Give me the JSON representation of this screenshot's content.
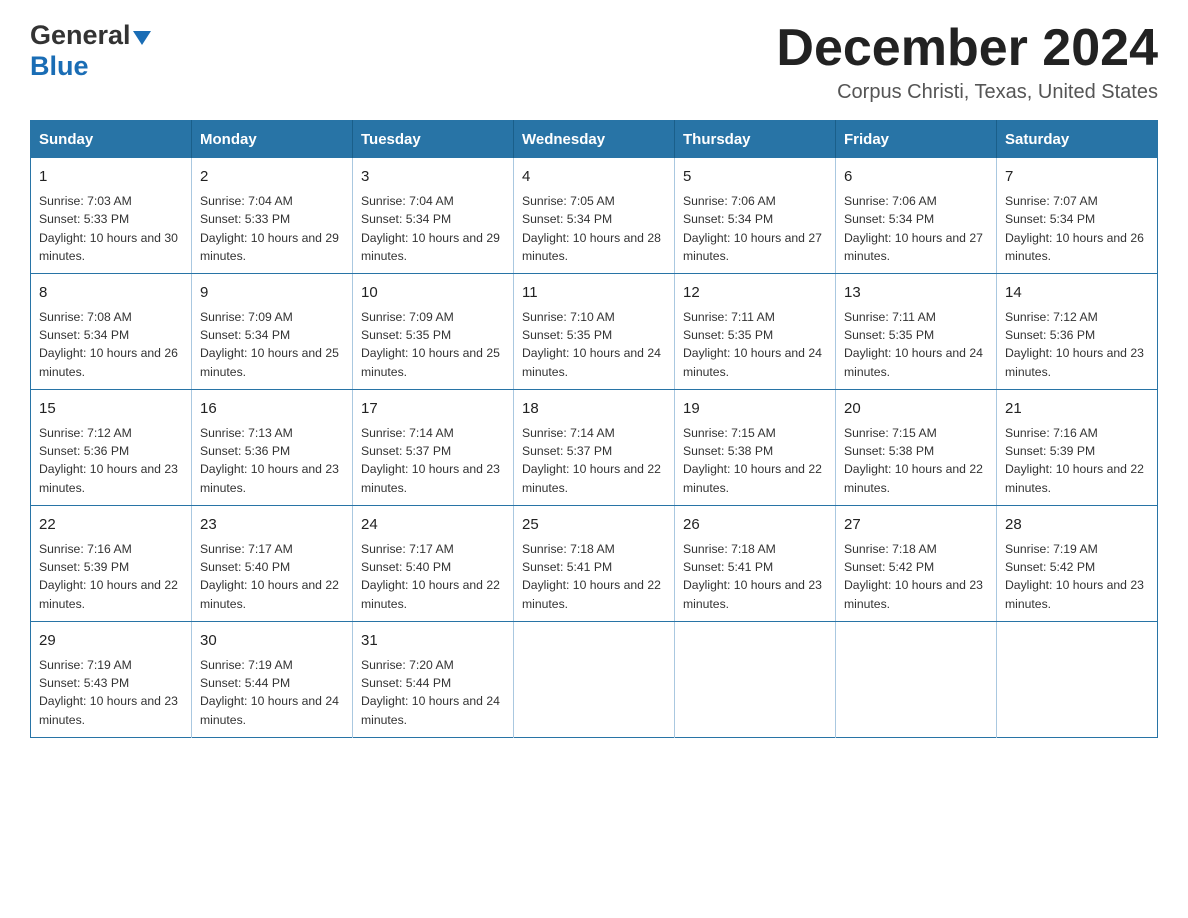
{
  "header": {
    "logo_general": "General",
    "logo_blue": "Blue",
    "title": "December 2024",
    "subtitle": "Corpus Christi, Texas, United States"
  },
  "weekdays": [
    "Sunday",
    "Monday",
    "Tuesday",
    "Wednesday",
    "Thursday",
    "Friday",
    "Saturday"
  ],
  "weeks": [
    [
      {
        "day": "1",
        "sunrise": "7:03 AM",
        "sunset": "5:33 PM",
        "daylight": "10 hours and 30 minutes."
      },
      {
        "day": "2",
        "sunrise": "7:04 AM",
        "sunset": "5:33 PM",
        "daylight": "10 hours and 29 minutes."
      },
      {
        "day": "3",
        "sunrise": "7:04 AM",
        "sunset": "5:34 PM",
        "daylight": "10 hours and 29 minutes."
      },
      {
        "day": "4",
        "sunrise": "7:05 AM",
        "sunset": "5:34 PM",
        "daylight": "10 hours and 28 minutes."
      },
      {
        "day": "5",
        "sunrise": "7:06 AM",
        "sunset": "5:34 PM",
        "daylight": "10 hours and 27 minutes."
      },
      {
        "day": "6",
        "sunrise": "7:06 AM",
        "sunset": "5:34 PM",
        "daylight": "10 hours and 27 minutes."
      },
      {
        "day": "7",
        "sunrise": "7:07 AM",
        "sunset": "5:34 PM",
        "daylight": "10 hours and 26 minutes."
      }
    ],
    [
      {
        "day": "8",
        "sunrise": "7:08 AM",
        "sunset": "5:34 PM",
        "daylight": "10 hours and 26 minutes."
      },
      {
        "day": "9",
        "sunrise": "7:09 AM",
        "sunset": "5:34 PM",
        "daylight": "10 hours and 25 minutes."
      },
      {
        "day": "10",
        "sunrise": "7:09 AM",
        "sunset": "5:35 PM",
        "daylight": "10 hours and 25 minutes."
      },
      {
        "day": "11",
        "sunrise": "7:10 AM",
        "sunset": "5:35 PM",
        "daylight": "10 hours and 24 minutes."
      },
      {
        "day": "12",
        "sunrise": "7:11 AM",
        "sunset": "5:35 PM",
        "daylight": "10 hours and 24 minutes."
      },
      {
        "day": "13",
        "sunrise": "7:11 AM",
        "sunset": "5:35 PM",
        "daylight": "10 hours and 24 minutes."
      },
      {
        "day": "14",
        "sunrise": "7:12 AM",
        "sunset": "5:36 PM",
        "daylight": "10 hours and 23 minutes."
      }
    ],
    [
      {
        "day": "15",
        "sunrise": "7:12 AM",
        "sunset": "5:36 PM",
        "daylight": "10 hours and 23 minutes."
      },
      {
        "day": "16",
        "sunrise": "7:13 AM",
        "sunset": "5:36 PM",
        "daylight": "10 hours and 23 minutes."
      },
      {
        "day": "17",
        "sunrise": "7:14 AM",
        "sunset": "5:37 PM",
        "daylight": "10 hours and 23 minutes."
      },
      {
        "day": "18",
        "sunrise": "7:14 AM",
        "sunset": "5:37 PM",
        "daylight": "10 hours and 22 minutes."
      },
      {
        "day": "19",
        "sunrise": "7:15 AM",
        "sunset": "5:38 PM",
        "daylight": "10 hours and 22 minutes."
      },
      {
        "day": "20",
        "sunrise": "7:15 AM",
        "sunset": "5:38 PM",
        "daylight": "10 hours and 22 minutes."
      },
      {
        "day": "21",
        "sunrise": "7:16 AM",
        "sunset": "5:39 PM",
        "daylight": "10 hours and 22 minutes."
      }
    ],
    [
      {
        "day": "22",
        "sunrise": "7:16 AM",
        "sunset": "5:39 PM",
        "daylight": "10 hours and 22 minutes."
      },
      {
        "day": "23",
        "sunrise": "7:17 AM",
        "sunset": "5:40 PM",
        "daylight": "10 hours and 22 minutes."
      },
      {
        "day": "24",
        "sunrise": "7:17 AM",
        "sunset": "5:40 PM",
        "daylight": "10 hours and 22 minutes."
      },
      {
        "day": "25",
        "sunrise": "7:18 AM",
        "sunset": "5:41 PM",
        "daylight": "10 hours and 22 minutes."
      },
      {
        "day": "26",
        "sunrise": "7:18 AM",
        "sunset": "5:41 PM",
        "daylight": "10 hours and 23 minutes."
      },
      {
        "day": "27",
        "sunrise": "7:18 AM",
        "sunset": "5:42 PM",
        "daylight": "10 hours and 23 minutes."
      },
      {
        "day": "28",
        "sunrise": "7:19 AM",
        "sunset": "5:42 PM",
        "daylight": "10 hours and 23 minutes."
      }
    ],
    [
      {
        "day": "29",
        "sunrise": "7:19 AM",
        "sunset": "5:43 PM",
        "daylight": "10 hours and 23 minutes."
      },
      {
        "day": "30",
        "sunrise": "7:19 AM",
        "sunset": "5:44 PM",
        "daylight": "10 hours and 24 minutes."
      },
      {
        "day": "31",
        "sunrise": "7:20 AM",
        "sunset": "5:44 PM",
        "daylight": "10 hours and 24 minutes."
      },
      null,
      null,
      null,
      null
    ]
  ],
  "labels": {
    "sunrise_prefix": "Sunrise: ",
    "sunset_prefix": "Sunset: ",
    "daylight_prefix": "Daylight: "
  }
}
